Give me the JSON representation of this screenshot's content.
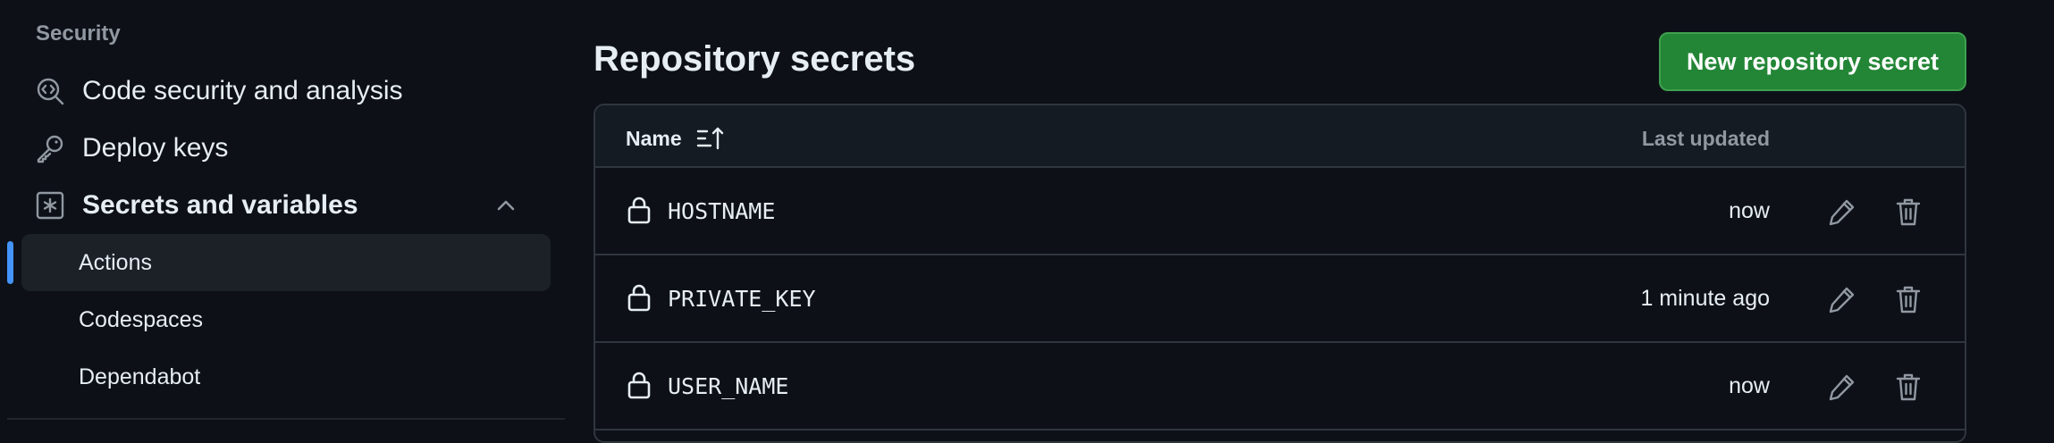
{
  "sidebar": {
    "section_title": "Security",
    "items": [
      {
        "label": "Code security and analysis",
        "icon": "codescan-icon"
      },
      {
        "label": "Deploy keys",
        "icon": "key-icon"
      },
      {
        "label": "Secrets and variables",
        "icon": "asterisk-icon",
        "expanded": true
      }
    ],
    "subitems": [
      {
        "label": "Actions",
        "active": true
      },
      {
        "label": "Codespaces",
        "active": false
      },
      {
        "label": "Dependabot",
        "active": false
      }
    ]
  },
  "main": {
    "title": "Repository secrets",
    "new_button_label": "New repository secret",
    "table": {
      "col_name": "Name",
      "col_updated": "Last updated",
      "rows": [
        {
          "name": "HOSTNAME",
          "updated": "now"
        },
        {
          "name": "PRIVATE_KEY",
          "updated": "1 minute ago"
        },
        {
          "name": "USER_NAME",
          "updated": "now"
        }
      ]
    }
  },
  "colors": {
    "background": "#0d1117",
    "primary_button": "#238636",
    "active_indicator": "#4493f8",
    "border": "#30363d"
  }
}
